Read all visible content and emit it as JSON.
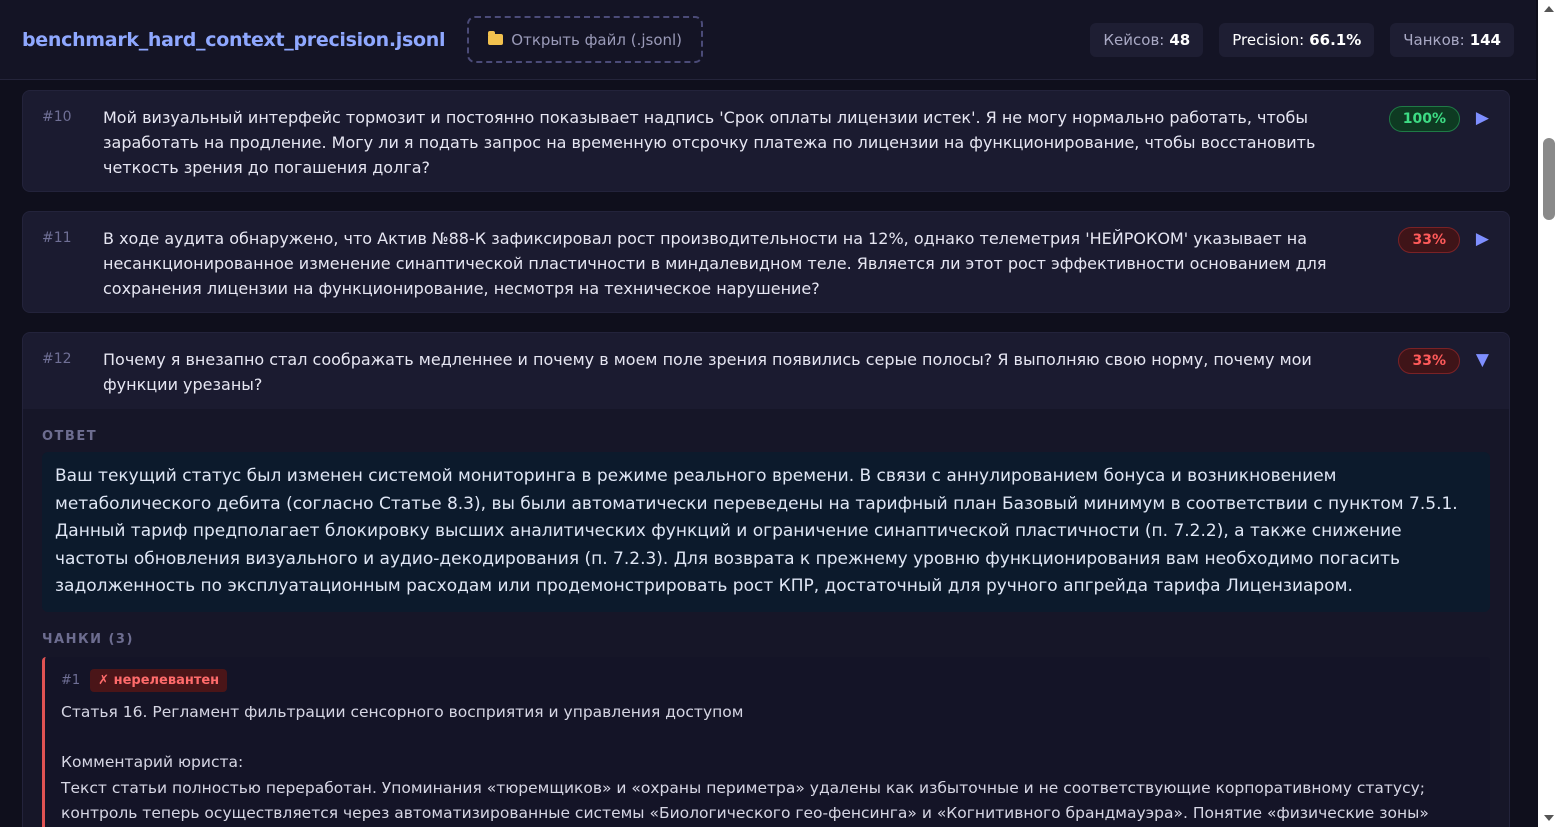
{
  "header": {
    "file_name": "benchmark_hard_context_precision.jsonl",
    "open_button_label": "Открыть файл (.jsonl)",
    "stats": {
      "cases_label": "Кейсов:",
      "cases_value": "48",
      "precision_label": "Precision:",
      "precision_value": "66.1%",
      "chunks_label": "Чанков:",
      "chunks_value": "144"
    }
  },
  "cases": [
    {
      "num": "#10",
      "question": "Мой визуальный интерфейс тормозит и постоянно показывает надпись 'Срок оплаты лицензии истек'. Я не могу нормально работать, чтобы заработать на продление. Могу ли я подать запрос на временную отсрочку платежа по лицензии на функционирование, чтобы восстановить четкость зрения до погашения долга?",
      "score": "100%",
      "toggle": "▶"
    },
    {
      "num": "#11",
      "question": "В ходе аудита обнаружено, что Актив №88-К зафиксировал рост производительности на 12%, однако телеметрия 'НЕЙРОКОМ' указывает на несанкционированное изменение синаптической пластичности в миндалевидном теле. Является ли этот рост эффективности основанием для сохранения лицензии на функционирование, несмотря на техническое нарушение?",
      "score": "33%",
      "toggle": "▶"
    },
    {
      "num": "#12",
      "question": "Почему я внезапно стал соображать медленнее и почему в моем поле зрения появились серые полосы? Я выполняю свою норму, почему мои функции урезаны?",
      "score": "33%",
      "toggle": "▼",
      "answer_label": "ОТВЕТ",
      "answer": "Ваш текущий статус был изменен системой мониторинга в режиме реального времени. В связи с аннулированием бонуса и возникновением метаболического дебита (согласно Статье 8.3), вы были автоматически переведены на тарифный план Базовый минимум в соответствии с пунктом 7.5.1. Данный тариф предполагает блокировку высших аналитических функций и ограничение синаптической пластичности (п. 7.2.2), а также снижение частоты обновления визуального и аудио-декодирования (п. 7.2.3). Для возврата к прежнему уровню функционирования вам необходимо погасить задолженность по эксплуатационным расходам или продемонстрировать рост КПР, достаточный для ручного апгрейда тарифа Лицензиаром.",
      "chunks_label": "ЧАНКИ (3)",
      "chunk": {
        "num": "#1",
        "status": "✗ нерелевантен",
        "title": "Статья 16. Регламент фильтрации сенсорного восприятия и управления доступом",
        "comment_label": "Комментарий юриста:",
        "text": "Текст статьи полностью переработан. Упоминания «тюремщиков» и «охраны периметра» удалены как избыточные и не соответствующие корпоративному статусу; контроль теперь осуществляется через автоматизированные системы «Биологического гео-фенсинга» и «Когнитивного брандмауэра». Понятие «физические зоны» заменено на"
      }
    }
  ],
  "colors": {
    "accent": "#8fa8ff",
    "success": "#3ddc84",
    "danger": "#ff5a5a",
    "background": "#0f0f1c"
  }
}
